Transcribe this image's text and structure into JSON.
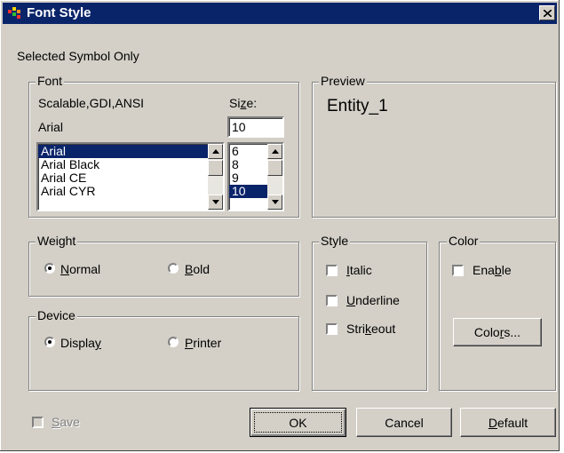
{
  "window": {
    "title": "Font Style",
    "close_icon": "close-icon"
  },
  "scope_label": "Selected Symbol Only",
  "font_group": {
    "legend": "Font",
    "font_type": "Scalable,GDI,ANSI",
    "current_font": "Arial",
    "size_label": "Size:",
    "size_value": "10",
    "font_list": [
      "Arial",
      "Arial Black",
      "Arial CE",
      "Arial CYR"
    ],
    "selected_font": "Arial",
    "size_list": [
      "6",
      "8",
      "9",
      "10"
    ],
    "selected_size": "10"
  },
  "preview_group": {
    "legend": "Preview",
    "sample_text": "Entity_1"
  },
  "weight_group": {
    "legend": "Weight",
    "normal_label": "Normal",
    "bold_label": "Bold",
    "selected": "Normal"
  },
  "device_group": {
    "legend": "Device",
    "display_label": "Display",
    "printer_label": "Printer",
    "selected": "Display"
  },
  "style_group": {
    "legend": "Style",
    "italic_label": "Italic",
    "underline_label": "Underline",
    "strikeout_label": "Strikeout"
  },
  "color_group": {
    "legend": "Color",
    "enable_label": "Enable",
    "colors_button": "Colors..."
  },
  "footer": {
    "save_label": "Save",
    "ok_button": "OK",
    "cancel_button": "Cancel",
    "default_button": "Default"
  },
  "colors": {
    "titlebar": "#0a246a",
    "face": "#d4d0c8",
    "selection": "#0a246a"
  }
}
